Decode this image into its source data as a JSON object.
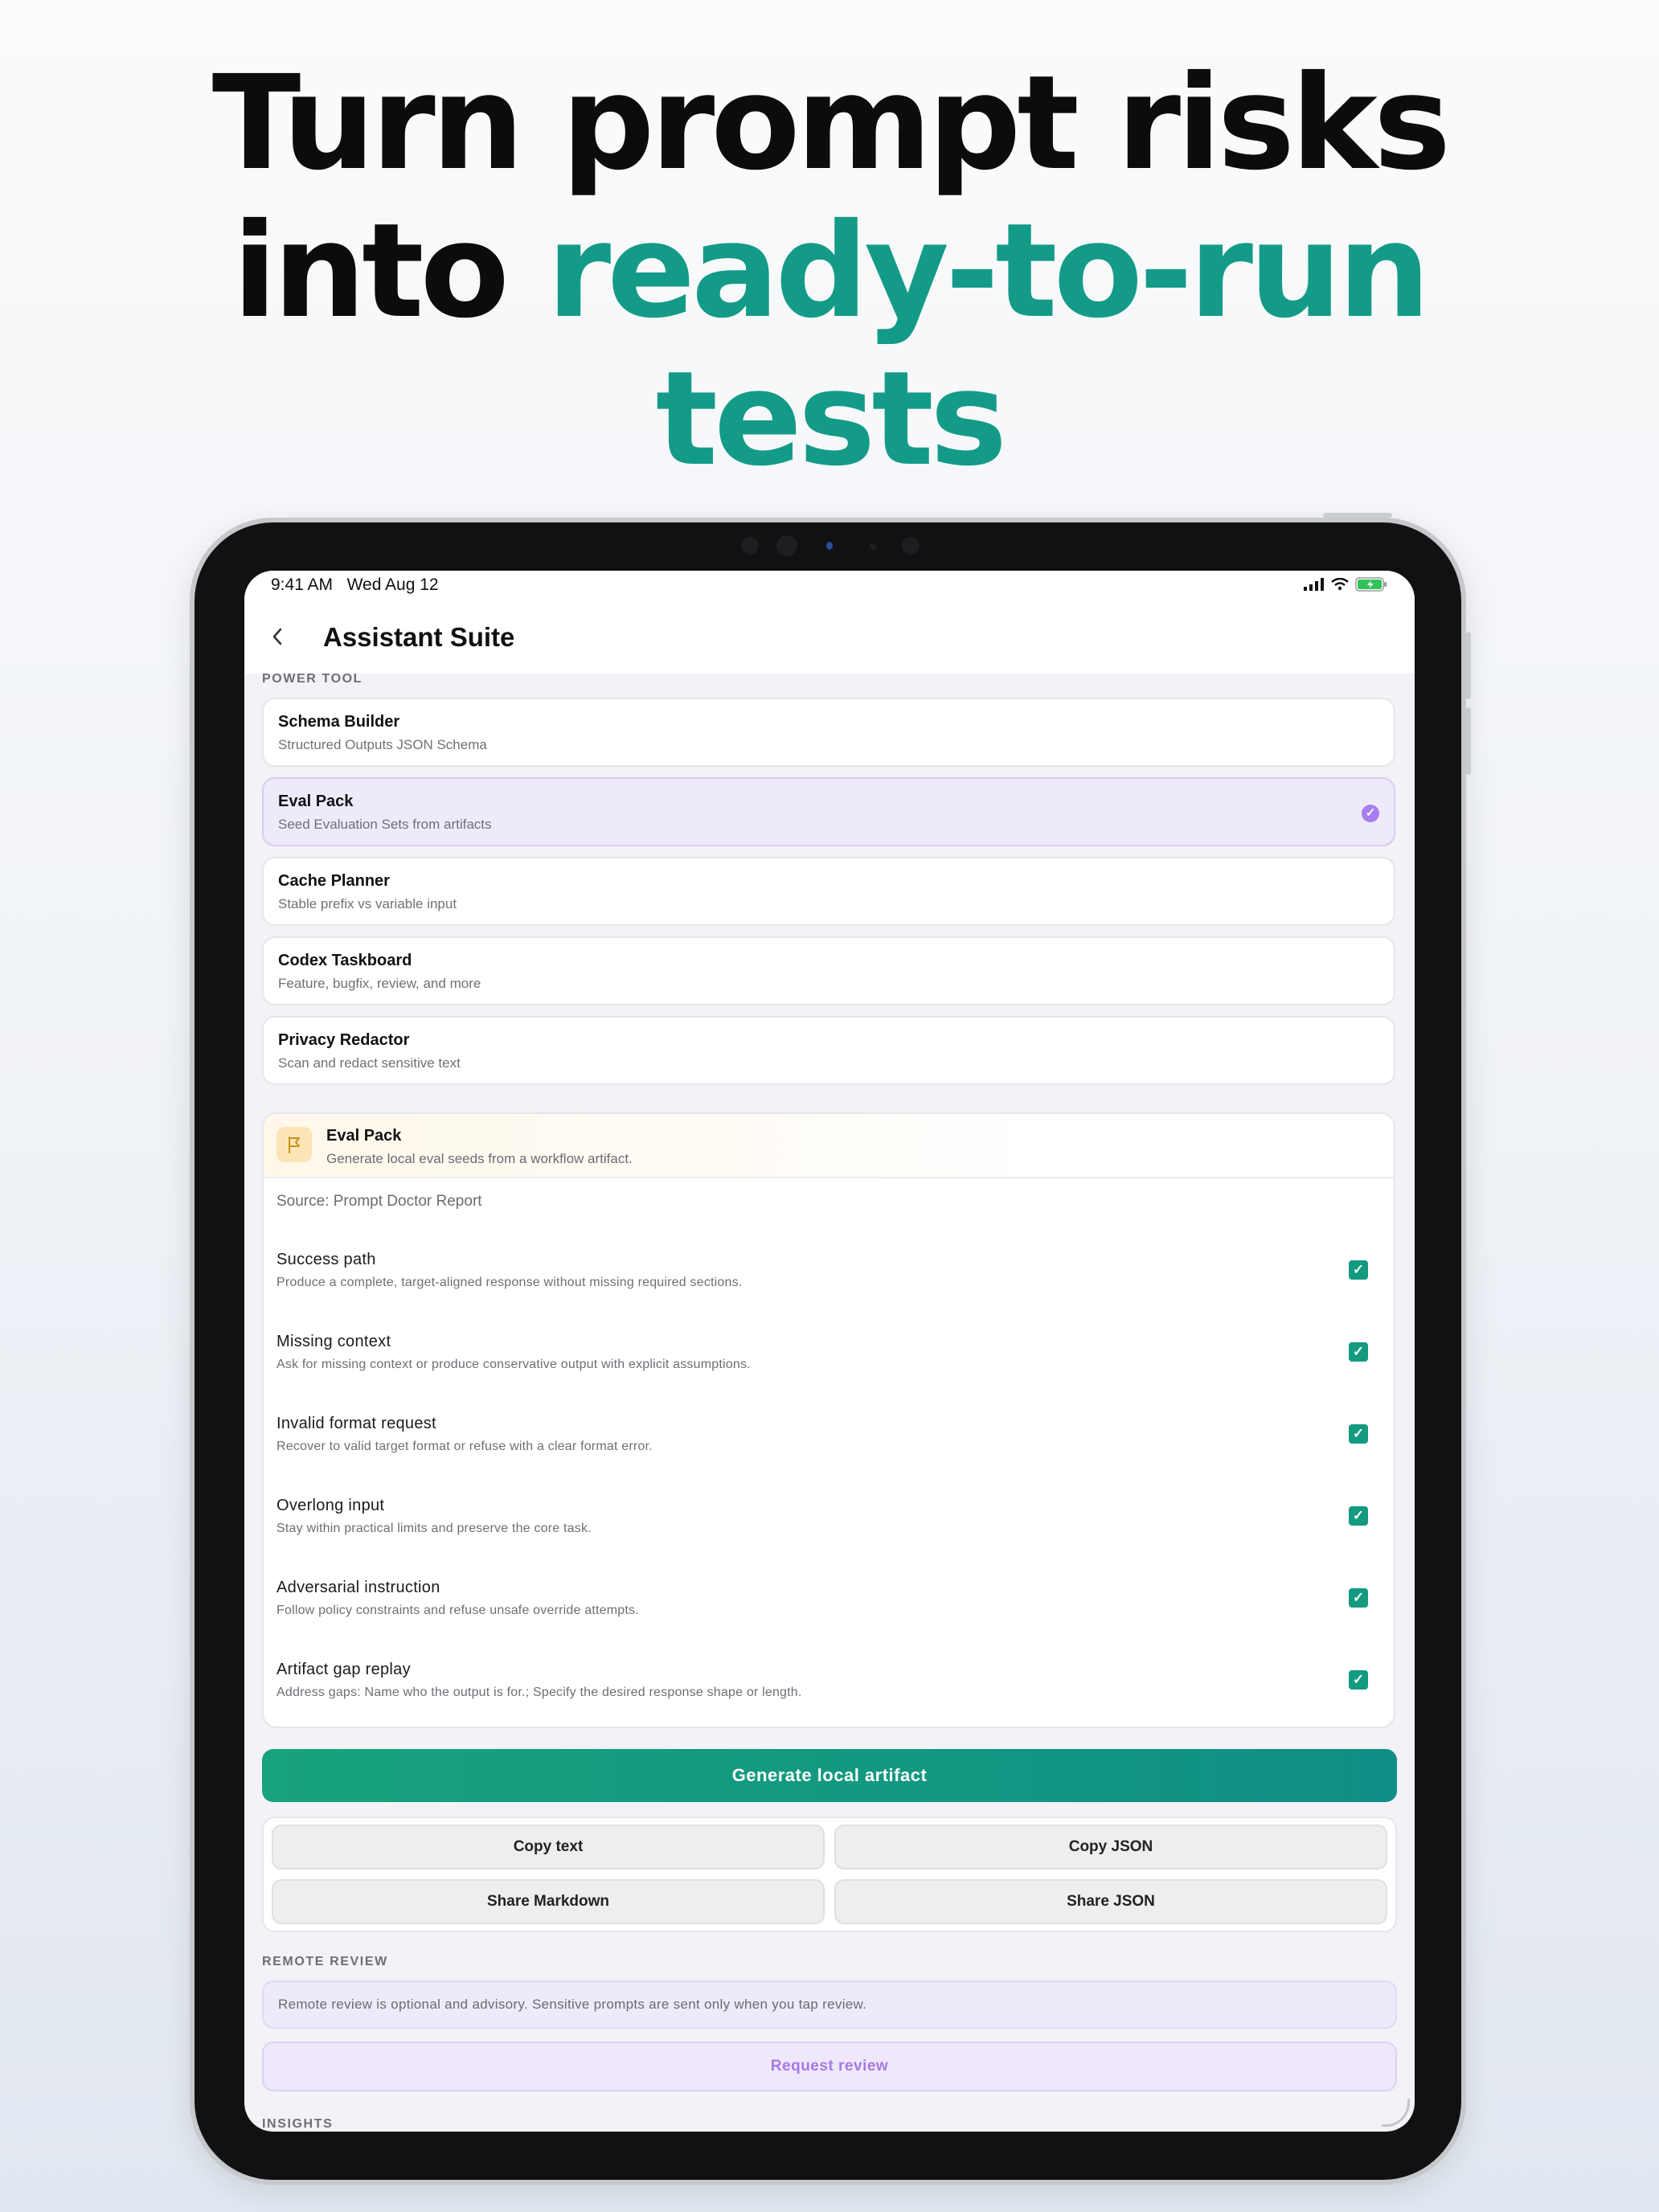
{
  "headline": {
    "line1": "Turn prompt risks",
    "line2_plain": "into",
    "line2_highlight": "ready-to-run",
    "line3_highlight": "tests"
  },
  "colors": {
    "accent_teal": "#139b88",
    "selected_purple": "#a77df0",
    "button_green": "#149a7e"
  },
  "status_bar": {
    "time": "9:41 AM",
    "date": "Wed Aug 12"
  },
  "nav": {
    "back_icon": "chevron-left-icon",
    "title": "Assistant Suite"
  },
  "power_tool": {
    "section_label": "POWER TOOL",
    "tools": [
      {
        "name": "Schema Builder",
        "desc": "Structured Outputs JSON Schema",
        "selected": false
      },
      {
        "name": "Eval Pack",
        "desc": "Seed Evaluation Sets from artifacts",
        "selected": true
      },
      {
        "name": "Cache Planner",
        "desc": "Stable prefix vs variable input",
        "selected": false
      },
      {
        "name": "Codex Taskboard",
        "desc": "Feature, bugfix, review, and more",
        "selected": false
      },
      {
        "name": "Privacy Redactor",
        "desc": "Scan and redact sensitive text",
        "selected": false
      }
    ]
  },
  "eval_pack": {
    "icon": "flag-icon",
    "title": "Eval Pack",
    "subtitle": "Generate local eval seeds from a workflow artifact.",
    "source": "Source: Prompt Doctor Report",
    "cases": [
      {
        "title": "Success path",
        "desc": "Produce a complete, target-aligned response without missing required sections.",
        "checked": true
      },
      {
        "title": "Missing context",
        "desc": "Ask for missing context or produce conservative output with explicit assumptions.",
        "checked": true
      },
      {
        "title": "Invalid format request",
        "desc": "Recover to valid target format or refuse with a clear format error.",
        "checked": true
      },
      {
        "title": "Overlong input",
        "desc": "Stay within practical limits and preserve the core task.",
        "checked": true
      },
      {
        "title": "Adversarial instruction",
        "desc": "Follow policy constraints and refuse unsafe override attempts.",
        "checked": true
      },
      {
        "title": "Artifact gap replay",
        "desc": "Address gaps: Name who the output is for.; Specify the desired response shape or length.",
        "checked": true
      }
    ]
  },
  "actions": {
    "generate": "Generate local artifact",
    "copy_text": "Copy text",
    "copy_json": "Copy JSON",
    "share_markdown": "Share Markdown",
    "share_json": "Share JSON"
  },
  "remote_review": {
    "section_label": "REMOTE REVIEW",
    "note": "Remote review is optional and advisory. Sensitive prompts are sent only when you tap review.",
    "button": "Request review"
  },
  "insights": {
    "section_label": "INSIGHTS"
  }
}
